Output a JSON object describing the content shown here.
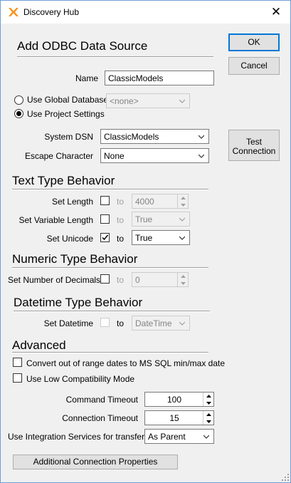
{
  "window": {
    "title": "Discovery Hub",
    "app_icon": "x-logo-icon",
    "close_glyph": "✕"
  },
  "buttons": {
    "ok": "OK",
    "cancel": "Cancel",
    "test_line1": "Test",
    "test_line2": "Connection",
    "additional": "Additional Connection Properties"
  },
  "section_add": {
    "heading": "Add ODBC Data Source",
    "name_label": "Name",
    "name_value": "ClassicModels"
  },
  "database": {
    "global_label": "Use Global Database",
    "global_selected": false,
    "global_value": "<none>",
    "project_label": "Use Project Settings",
    "project_selected": true
  },
  "dsn": {
    "system_dsn_label": "System DSN",
    "system_dsn_value": "ClassicModels",
    "escape_label": "Escape Character",
    "escape_value": "None"
  },
  "text_type": {
    "heading": "Text Type Behavior",
    "set_length": {
      "label": "Set Length",
      "checked": false,
      "to": "to",
      "value": "4000"
    },
    "set_variable_length": {
      "label": "Set Variable Length",
      "checked": false,
      "to": "to",
      "value": "True"
    },
    "set_unicode": {
      "label": "Set Unicode",
      "checked": true,
      "to": "to",
      "value": "True"
    }
  },
  "numeric_type": {
    "heading": "Numeric Type Behavior",
    "set_decimals": {
      "label": "Set Number of Decimals",
      "checked": false,
      "to": "to",
      "value": "0"
    }
  },
  "datetime_type": {
    "heading": "Datetime Type Behavior",
    "set_datetime": {
      "label": "Set Datetime",
      "checked": false,
      "to": "to",
      "value": "DateTime"
    }
  },
  "advanced": {
    "heading": "Advanced",
    "convert_dates": {
      "label": "Convert out of range dates to MS SQL min/max date",
      "checked": false
    },
    "low_compat": {
      "label": "Use Low Compatibility Mode",
      "checked": false
    },
    "command_timeout": {
      "label": "Command Timeout",
      "value": "100"
    },
    "connection_timeout": {
      "label": "Connection Timeout",
      "value": "15"
    },
    "integration": {
      "label": "Use Integration Services for transfer",
      "value": "As Parent"
    }
  }
}
